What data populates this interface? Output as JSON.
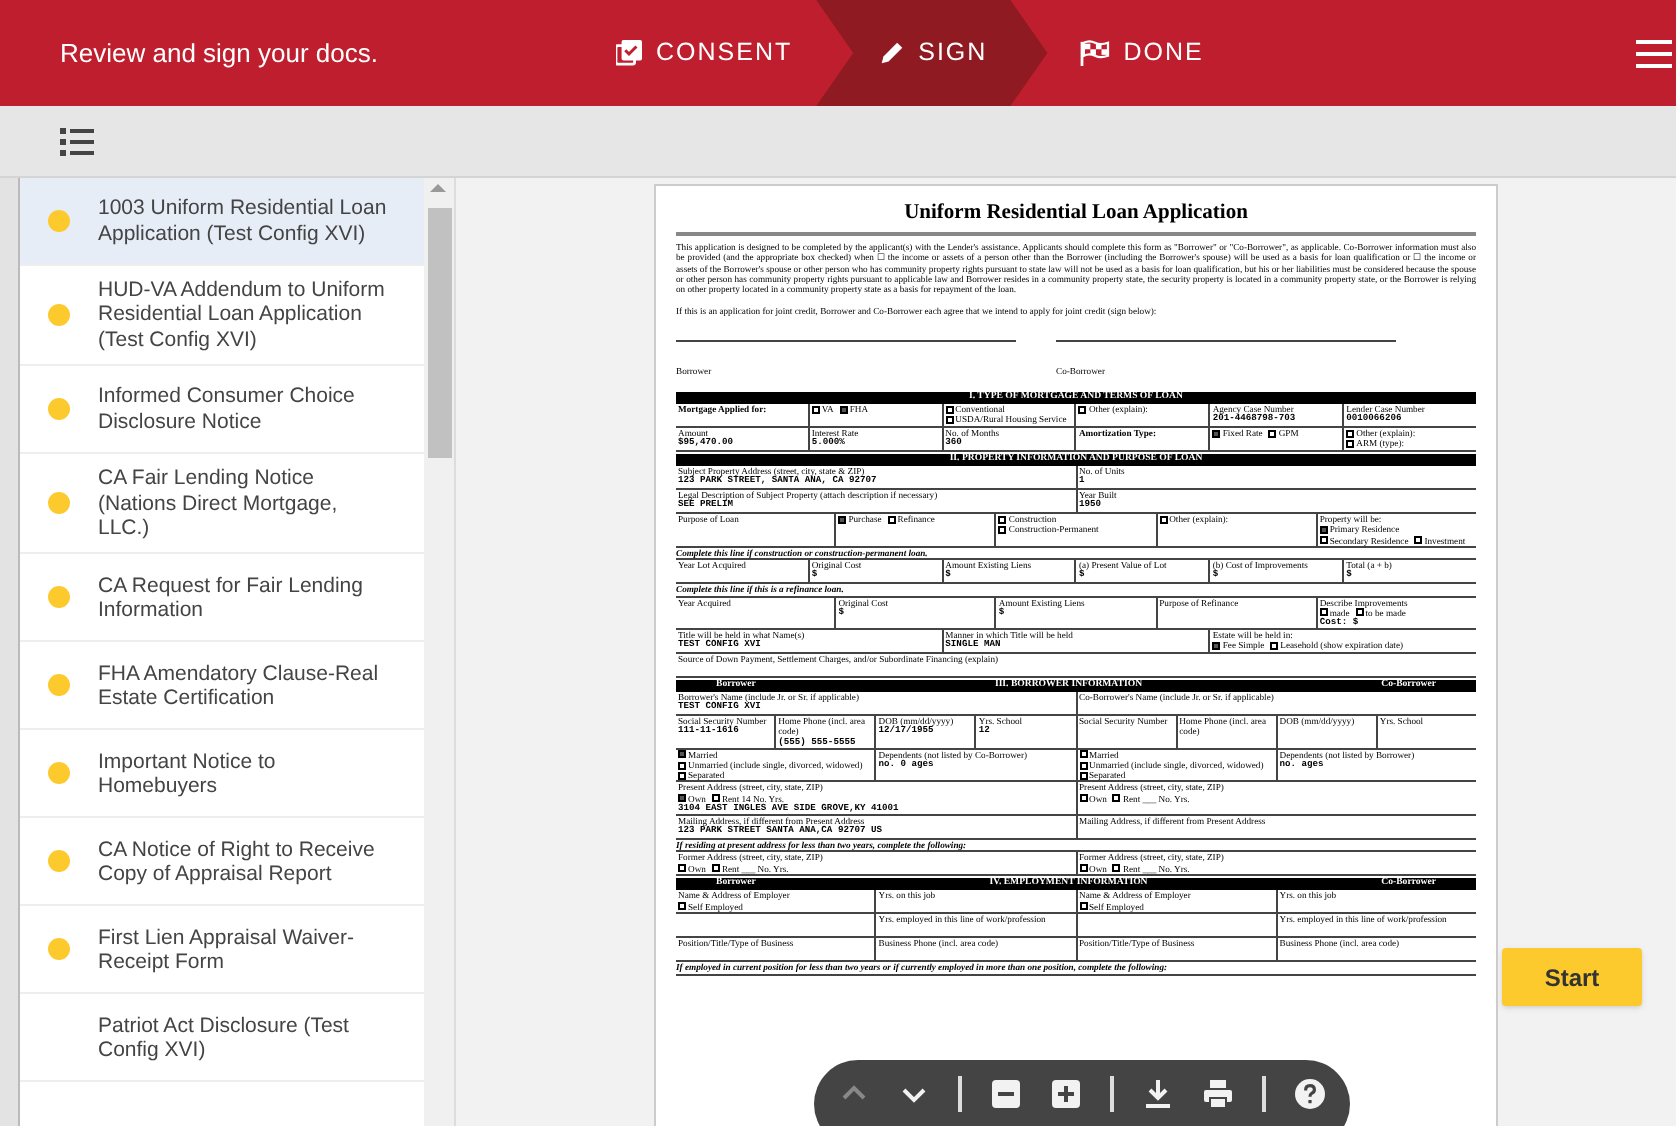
{
  "header": {
    "title": "Review and sign your docs.",
    "steps": [
      {
        "kind": "consent",
        "label": "CONSENT",
        "selected": false
      },
      {
        "kind": "sign",
        "label": "SIGN",
        "selected": true
      },
      {
        "kind": "done",
        "label": "DONE",
        "selected": false
      }
    ]
  },
  "documents": [
    {
      "title": "1003 Uniform Residential Loan Application (Test Config XVI)",
      "selected": true,
      "pending": true
    },
    {
      "title": "HUD-VA Addendum to Uniform Residential Loan Application (Test Config XVI)",
      "selected": false,
      "pending": true
    },
    {
      "title": "Informed Consumer Choice Disclosure Notice",
      "selected": false,
      "pending": true
    },
    {
      "title": "CA Fair Lending Notice (Nations Direct Mortgage, LLC.)",
      "selected": false,
      "pending": true
    },
    {
      "title": "CA Request for Fair Lending Information",
      "selected": false,
      "pending": true
    },
    {
      "title": "FHA Amendatory Clause-Real Estate Certification",
      "selected": false,
      "pending": true
    },
    {
      "title": "Important Notice to Homebuyers",
      "selected": false,
      "pending": true
    },
    {
      "title": "CA Notice of Right to Receive Copy of Appraisal Report",
      "selected": false,
      "pending": true
    },
    {
      "title": "First Lien Appraisal Waiver-Receipt Form",
      "selected": false,
      "pending": true
    },
    {
      "title": "Patriot Act Disclosure (Test Config XVI)",
      "selected": false,
      "pending": false
    }
  ],
  "preview": {
    "title": "Uniform Residential Loan Application",
    "intro": "This application is designed to be completed by the applicant(s) with the Lender's assistance. Applicants should complete this form as \"Borrower\" or \"Co-Borrower\", as applicable. Co-Borrower information must also be provided (and the appropriate box checked) when ☐ the income or assets of a person other than the Borrower (including the Borrower's spouse) will be used as a basis for loan qualification or ☐ the income or assets of the Borrower's spouse or other person who has community property rights pursuant to state law will not be used as a basis for loan qualification, but his or her liabilities must be considered because the spouse or other person has community property rights pursuant to applicable law and Borrower resides in a community property state, the security property is located in a community property state, or the Borrower is relying on other property located in a community property state as a basis for repayment of the loan.",
    "joint_note": "If this is an application for joint credit, Borrower and Co-Borrower each agree that we intend to apply for joint credit (sign below):",
    "signature_lines": [
      "Borrower",
      "Co-Borrower"
    ],
    "sections": [
      {
        "title": "I. TYPE OF MORTGAGE AND TERMS OF LOAN",
        "rows": [
          {
            "cells": [
              {
                "label": "Mortgage Applied for:",
                "bold": true
              },
              {
                "options": [
                  {
                    "label": "VA",
                    "checked": false
                  },
                  {
                    "label": "FHA",
                    "checked": true
                  }
                ]
              },
              {
                "options": [
                  {
                    "label": "Conventional",
                    "checked": false
                  },
                  {
                    "label": "USDA/Rural Housing Service",
                    "checked": false
                  }
                ]
              },
              {
                "options": [
                  {
                    "label": "Other (explain):",
                    "checked": false
                  }
                ]
              },
              {
                "label": "Agency Case Number",
                "value": "201-4468798-703"
              },
              {
                "label": "Lender Case Number",
                "value": "0010066206"
              }
            ]
          },
          {
            "cells": [
              {
                "label": "Amount",
                "value": "$95,470.00"
              },
              {
                "label": "Interest Rate",
                "value": "5.000%"
              },
              {
                "label": "No. of Months",
                "value": "360"
              },
              {
                "label": "Amortization Type:",
                "bold": true
              },
              {
                "options": [
                  {
                    "label": "Fixed Rate",
                    "checked": true
                  },
                  {
                    "label": "GPM",
                    "checked": false
                  }
                ]
              },
              {
                "options": [
                  {
                    "label": "Other (explain):",
                    "checked": false
                  },
                  {
                    "label": "ARM (type):",
                    "checked": false
                  }
                ]
              }
            ]
          }
        ]
      },
      {
        "title": "II. PROPERTY INFORMATION AND PURPOSE OF LOAN",
        "rows": [
          {
            "cells": [
              {
                "label": "Subject Property Address (street, city, state & ZIP)",
                "value": "123 PARK STREET, SANTA ANA, CA 92707"
              },
              {
                "label": "No. of Units",
                "value": "1"
              }
            ]
          },
          {
            "cells": [
              {
                "label": "Legal Description of Subject Property (attach description if necessary)",
                "value": "SEE PRELIM"
              },
              {
                "label": "Year Built",
                "value": "1950"
              }
            ]
          },
          {
            "cells": [
              {
                "label": "Purpose of Loan"
              },
              {
                "options": [
                  {
                    "label": "Purchase",
                    "checked": true
                  },
                  {
                    "label": "Refinance",
                    "checked": false
                  }
                ]
              },
              {
                "options": [
                  {
                    "label": "Construction",
                    "checked": false
                  },
                  {
                    "label": "Construction-Permanent",
                    "checked": false
                  }
                ]
              },
              {
                "options": [
                  {
                    "label": "Other (explain):",
                    "checked": false
                  }
                ]
              },
              {
                "label": "Property will be:",
                "options": [
                  {
                    "label": "Primary Residence",
                    "checked": true
                  },
                  {
                    "label": "Secondary Residence",
                    "checked": false
                  },
                  {
                    "label": "Investment",
                    "checked": false
                  }
                ]
              }
            ]
          },
          {
            "note": "Complete this line if construction or construction-permanent loan."
          },
          {
            "cells": [
              {
                "label": "Year Lot Acquired"
              },
              {
                "label": "Original Cost",
                "value": "$"
              },
              {
                "label": "Amount Existing Liens",
                "value": "$"
              },
              {
                "label": "(a) Present Value of Lot",
                "value": "$"
              },
              {
                "label": "(b) Cost of Improvements",
                "value": "$"
              },
              {
                "label": "Total (a + b)",
                "value": "$"
              }
            ]
          },
          {
            "note": "Complete this line if this is a refinance loan."
          },
          {
            "cells": [
              {
                "label": "Year Acquired"
              },
              {
                "label": "Original Cost",
                "value": "$"
              },
              {
                "label": "Amount Existing Liens",
                "value": "$"
              },
              {
                "label": "Purpose of Refinance"
              },
              {
                "label": "Describe Improvements",
                "options": [
                  {
                    "label": "made",
                    "checked": false
                  },
                  {
                    "label": "to be made",
                    "checked": false
                  }
                ],
                "value": "Cost: $"
              }
            ]
          },
          {
            "cells": [
              {
                "label": "Title will be held in what Name(s)",
                "value": "TEST CONFIG XVI"
              },
              {
                "label": "Manner in which Title will be held",
                "value": "SINGLE MAN"
              },
              {
                "label": "Estate will be held in:",
                "options": [
                  {
                    "label": "Fee Simple",
                    "checked": true
                  },
                  {
                    "label": "Leasehold (show expiration date)",
                    "checked": false
                  }
                ]
              }
            ]
          },
          {
            "cells": [
              {
                "label": "Source of Down Payment, Settlement Charges, and/or Subordinate Financing (explain)"
              }
            ]
          }
        ]
      },
      {
        "left": "Borrower",
        "title": "III. BORROWER INFORMATION",
        "right": "Co-Borrower",
        "rows": [
          {
            "cells": [
              {
                "label": "Borrower's Name (include Jr. or Sr. if applicable)",
                "value": "TEST CONFIG XVI"
              },
              {
                "label": "Co-Borrower's Name (include Jr. or Sr. if applicable)"
              }
            ]
          },
          {
            "cells": [
              {
                "label": "Social Security Number",
                "value": "111-11-1616"
              },
              {
                "label": "Home Phone (incl. area code)",
                "value": "(555) 555-5555"
              },
              {
                "label": "DOB (mm/dd/yyyy)",
                "value": "12/17/1955"
              },
              {
                "label": "Yrs. School",
                "value": "12"
              },
              {
                "label": "Social Security Number"
              },
              {
                "label": "Home Phone (incl. area code)"
              },
              {
                "label": "DOB (mm/dd/yyyy)"
              },
              {
                "label": "Yrs. School"
              }
            ]
          },
          {
            "cells": [
              {
                "options": [
                  {
                    "label": "Married",
                    "checked": true
                  },
                  {
                    "label": "Unmarried (include single, divorced, widowed)",
                    "checked": false
                  },
                  {
                    "label": "Separated",
                    "checked": false
                  }
                ]
              },
              {
                "label": "Dependents (not listed by Co-Borrower)",
                "value": "no. 0 ages"
              },
              {
                "options": [
                  {
                    "label": "Married",
                    "checked": false
                  },
                  {
                    "label": "Unmarried (include single, divorced, widowed)",
                    "checked": false
                  },
                  {
                    "label": "Separated",
                    "checked": false
                  }
                ]
              },
              {
                "label": "Dependents (not listed by Borrower)",
                "value": "no. ages"
              }
            ]
          },
          {
            "cells": [
              {
                "label": "Present Address (street, city, state, ZIP)",
                "options": [
                  {
                    "label": "Own",
                    "checked": true
                  },
                  {
                    "label": "Rent 14 No. Yrs.",
                    "checked": false
                  }
                ],
                "value": "3104 EAST INGLES AVE SIDE GROVE,KY 41001"
              },
              {
                "label": "Present Address (street, city, state, ZIP)",
                "options": [
                  {
                    "label": "Own",
                    "checked": false
                  },
                  {
                    "label": "Rent ___ No. Yrs.",
                    "checked": false
                  }
                ]
              }
            ]
          },
          {
            "cells": [
              {
                "label": "Mailing Address, if different from Present Address",
                "value": "123 PARK STREET SANTA ANA,CA 92707 US"
              },
              {
                "label": "Mailing Address, if different from Present Address"
              }
            ]
          },
          {
            "note": "If residing at present address for less than two years, complete the following:"
          },
          {
            "cells": [
              {
                "label": "Former Address (street, city, state, ZIP)",
                "options": [
                  {
                    "label": "Own",
                    "checked": false
                  },
                  {
                    "label": "Rent ___ No. Yrs.",
                    "checked": false
                  }
                ]
              },
              {
                "label": "Former Address (street, city, state, ZIP)",
                "options": [
                  {
                    "label": "Own",
                    "checked": false
                  },
                  {
                    "label": "Rent ___ No. Yrs.",
                    "checked": false
                  }
                ]
              }
            ]
          }
        ]
      },
      {
        "left": "Borrower",
        "title": "IV. EMPLOYMENT INFORMATION",
        "right": "Co-Borrower",
        "rows": [
          {
            "cells": [
              {
                "label": "Name & Address of Employer",
                "options": [
                  {
                    "label": "Self Employed",
                    "checked": false
                  }
                ]
              },
              {
                "label": "Yrs. on this job"
              },
              {
                "label": "Name & Address of Employer",
                "options": [
                  {
                    "label": "Self Employed",
                    "checked": false
                  }
                ]
              },
              {
                "label": "Yrs. on this job"
              }
            ]
          },
          {
            "cells": [
              {},
              {
                "label": "Yrs. employed in this line of work/profession"
              },
              {},
              {
                "label": "Yrs. employed in this line of work/profession"
              }
            ]
          },
          {
            "cells": [
              {
                "label": "Position/Title/Type of Business"
              },
              {
                "label": "Business Phone (incl. area code)"
              },
              {
                "label": "Position/Title/Type of Business"
              },
              {
                "label": "Business Phone (incl. area code)"
              }
            ]
          },
          {
            "note": "If employed in current position for less than two years or if currently employed in more than one position, complete the following:"
          }
        ]
      }
    ]
  },
  "start_button": "Start",
  "viewer_toolbar": [
    {
      "kind": "previous",
      "disabled": true
    },
    {
      "kind": "next",
      "disabled": false
    },
    {
      "kind": "separator"
    },
    {
      "kind": "zoom-out",
      "disabled": false
    },
    {
      "kind": "zoom-in",
      "disabled": false
    },
    {
      "kind": "separator"
    },
    {
      "kind": "download",
      "disabled": false
    },
    {
      "kind": "print",
      "disabled": false
    },
    {
      "kind": "separator"
    },
    {
      "kind": "help",
      "disabled": false
    }
  ]
}
